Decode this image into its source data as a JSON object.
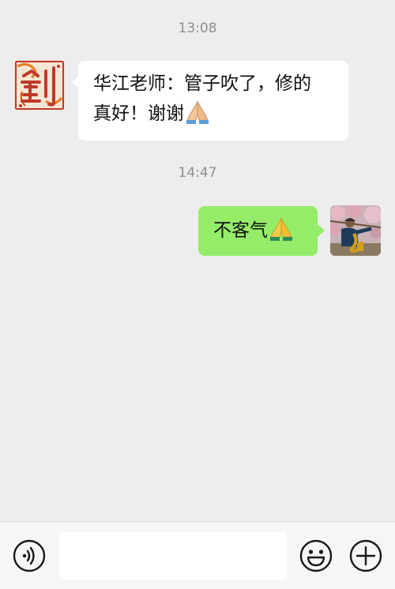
{
  "messages": [
    {
      "time": "13:08",
      "sender": "other",
      "line1": "华江老师：管子吹了，修的",
      "line2": "真好！谢谢",
      "emoji": "folded-hands-icon"
    },
    {
      "time": "14:47",
      "sender": "self",
      "text": "不客气",
      "emoji": "folded-hands-icon"
    }
  ],
  "input_bar": {
    "placeholder": "",
    "voice_icon": "voice-icon",
    "emoji_icon": "smiley-icon",
    "more_icon": "plus-icon"
  },
  "colors": {
    "background": "#ededed",
    "incoming_bubble": "#ffffff",
    "outgoing_bubble": "#95ec69"
  }
}
